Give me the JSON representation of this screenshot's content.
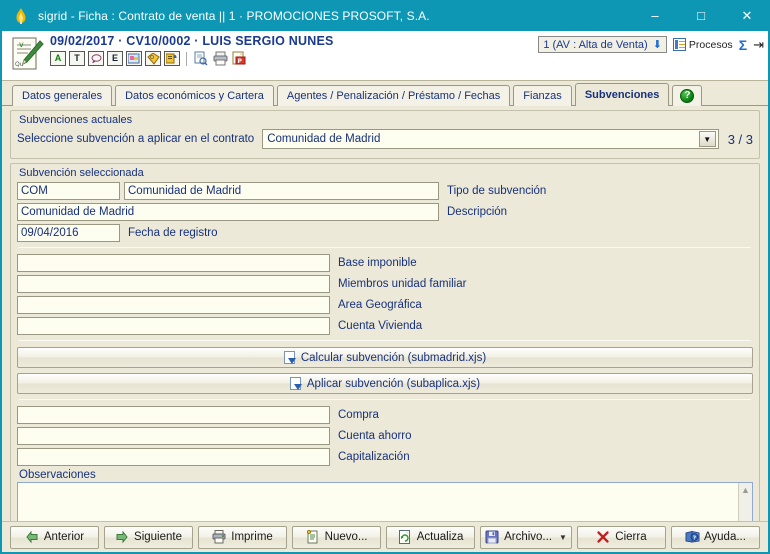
{
  "window": {
    "title": "sigrid - Ficha : Contrato de venta || 1 · PROMOCIONES PROSOFT, S.A.",
    "app_icon": "flame-icon",
    "minimize": "–",
    "maximize": "□",
    "close": "✕",
    "titlebar_color": "#0d97b5"
  },
  "header": {
    "record_title": "09/02/2017 · CV10/0002 · LUIS SERGIO NUNES",
    "doc_icon": "document-pencil-icon",
    "toolbar_icons": [
      {
        "name": "annotation-a-icon",
        "glyph": "A"
      },
      {
        "name": "text-t-icon",
        "glyph": "T"
      },
      {
        "name": "comment-bubble-icon",
        "glyph": "◯"
      },
      {
        "name": "email-e-icon",
        "glyph": "E"
      },
      {
        "name": "image-gallery-icon",
        "glyph": "▨"
      },
      {
        "name": "tags-icon",
        "glyph": "◈"
      },
      {
        "name": "alert-bell-icon",
        "glyph": "▤"
      },
      {
        "name": "preview-icon",
        "glyph": "🔍"
      },
      {
        "name": "print-icon",
        "glyph": "🖶"
      },
      {
        "name": "pdf-icon",
        "glyph": "▤"
      }
    ],
    "state_value": "1 (AV : Alta de Venta)",
    "state_arrow": "⬇",
    "procesos_label": "Procesos",
    "procesos_icon": "grid-processes-icon",
    "sigma_icon": "sigma-icon",
    "sigma_glyph": "Σ",
    "pin_icon": "pin-icon",
    "pin_glyph": "⇥"
  },
  "tabs": [
    {
      "label": "Datos generales",
      "active": false,
      "name": "tab-datos-generales"
    },
    {
      "label": "Datos económicos y Cartera",
      "active": false,
      "name": "tab-datos-economicos"
    },
    {
      "label": "Agentes / Penalización / Préstamo / Fechas",
      "active": false,
      "name": "tab-agentes"
    },
    {
      "label": "Fianzas",
      "active": false,
      "name": "tab-fianzas"
    },
    {
      "label": "Subvenciones",
      "active": true,
      "name": "tab-subvenciones"
    }
  ],
  "help_tab": {
    "glyph": "?",
    "name": "tab-help"
  },
  "subvenciones_actuales": {
    "group_label": "Subvenciones actuales",
    "select_label": "Seleccione subvención a aplicar en el contrato",
    "select_value": "Comunidad de Madrid",
    "counter": "3 / 3"
  },
  "subvencion_seleccionada": {
    "group_label": "Subvención seleccionada",
    "tipo_code": "COM",
    "tipo_name": "Comunidad de Madrid",
    "tipo_label": "Tipo de subvención",
    "descripcion_value": "Comunidad de Madrid",
    "descripcion_label": "Descripción",
    "fecha_value": "09/04/2016",
    "fecha_label": "Fecha de registro",
    "fields": [
      {
        "value": "",
        "label": "Base imponible",
        "name": "field-base-imponible"
      },
      {
        "value": "",
        "label": "Miembros unidad familiar",
        "name": "field-miembros-unidad-familiar"
      },
      {
        "value": "",
        "label": "Area Geográfica",
        "name": "field-area-geografica"
      },
      {
        "value": "",
        "label": "Cuenta Vivienda",
        "name": "field-cuenta-vivienda"
      }
    ],
    "actions": [
      {
        "label": "Calcular subvención (submadrid.xjs)",
        "name": "calcular-subvencion-button"
      },
      {
        "label": "Aplicar subvención (subaplica.xjs)",
        "name": "aplicar-subvencion-button"
      }
    ],
    "fields2": [
      {
        "value": "",
        "label": "Compra",
        "name": "field-compra"
      },
      {
        "value": "",
        "label": "Cuenta ahorro",
        "name": "field-cuenta-ahorro"
      },
      {
        "value": "",
        "label": "Capitalización",
        "name": "field-capitalizacion"
      }
    ],
    "observaciones_label": "Observaciones",
    "observaciones_value": "",
    "scroll_up": "▲",
    "scroll_down": "▼"
  },
  "bottom_buttons": [
    {
      "label": "Anterior",
      "icon": "arrow-left-icon",
      "name": "anterior-button",
      "caret": false
    },
    {
      "label": "Siguiente",
      "icon": "arrow-right-icon",
      "name": "siguiente-button",
      "caret": false
    },
    {
      "label": "Imprime",
      "icon": "printer-icon",
      "name": "imprime-button",
      "caret": false
    },
    {
      "label": "Nuevo...",
      "icon": "new-document-icon",
      "name": "nuevo-button",
      "caret": false
    },
    {
      "label": "Actualiza",
      "icon": "refresh-icon",
      "name": "actualiza-button",
      "caret": false
    },
    {
      "label": "Archivo...",
      "icon": "save-floppy-icon",
      "name": "archivo-button",
      "caret": true
    },
    {
      "label": "Cierra",
      "icon": "close-x-icon",
      "name": "cierra-button",
      "caret": false
    },
    {
      "label": "Ayuda...",
      "icon": "help-book-icon",
      "name": "ayuda-button",
      "caret": false
    }
  ],
  "colors": {
    "titlebar": "#0d97b5",
    "panel": "#ece9d8",
    "field": "#fdfdf0",
    "label_text": "#17317c",
    "active_tab_text": "#17317c"
  }
}
